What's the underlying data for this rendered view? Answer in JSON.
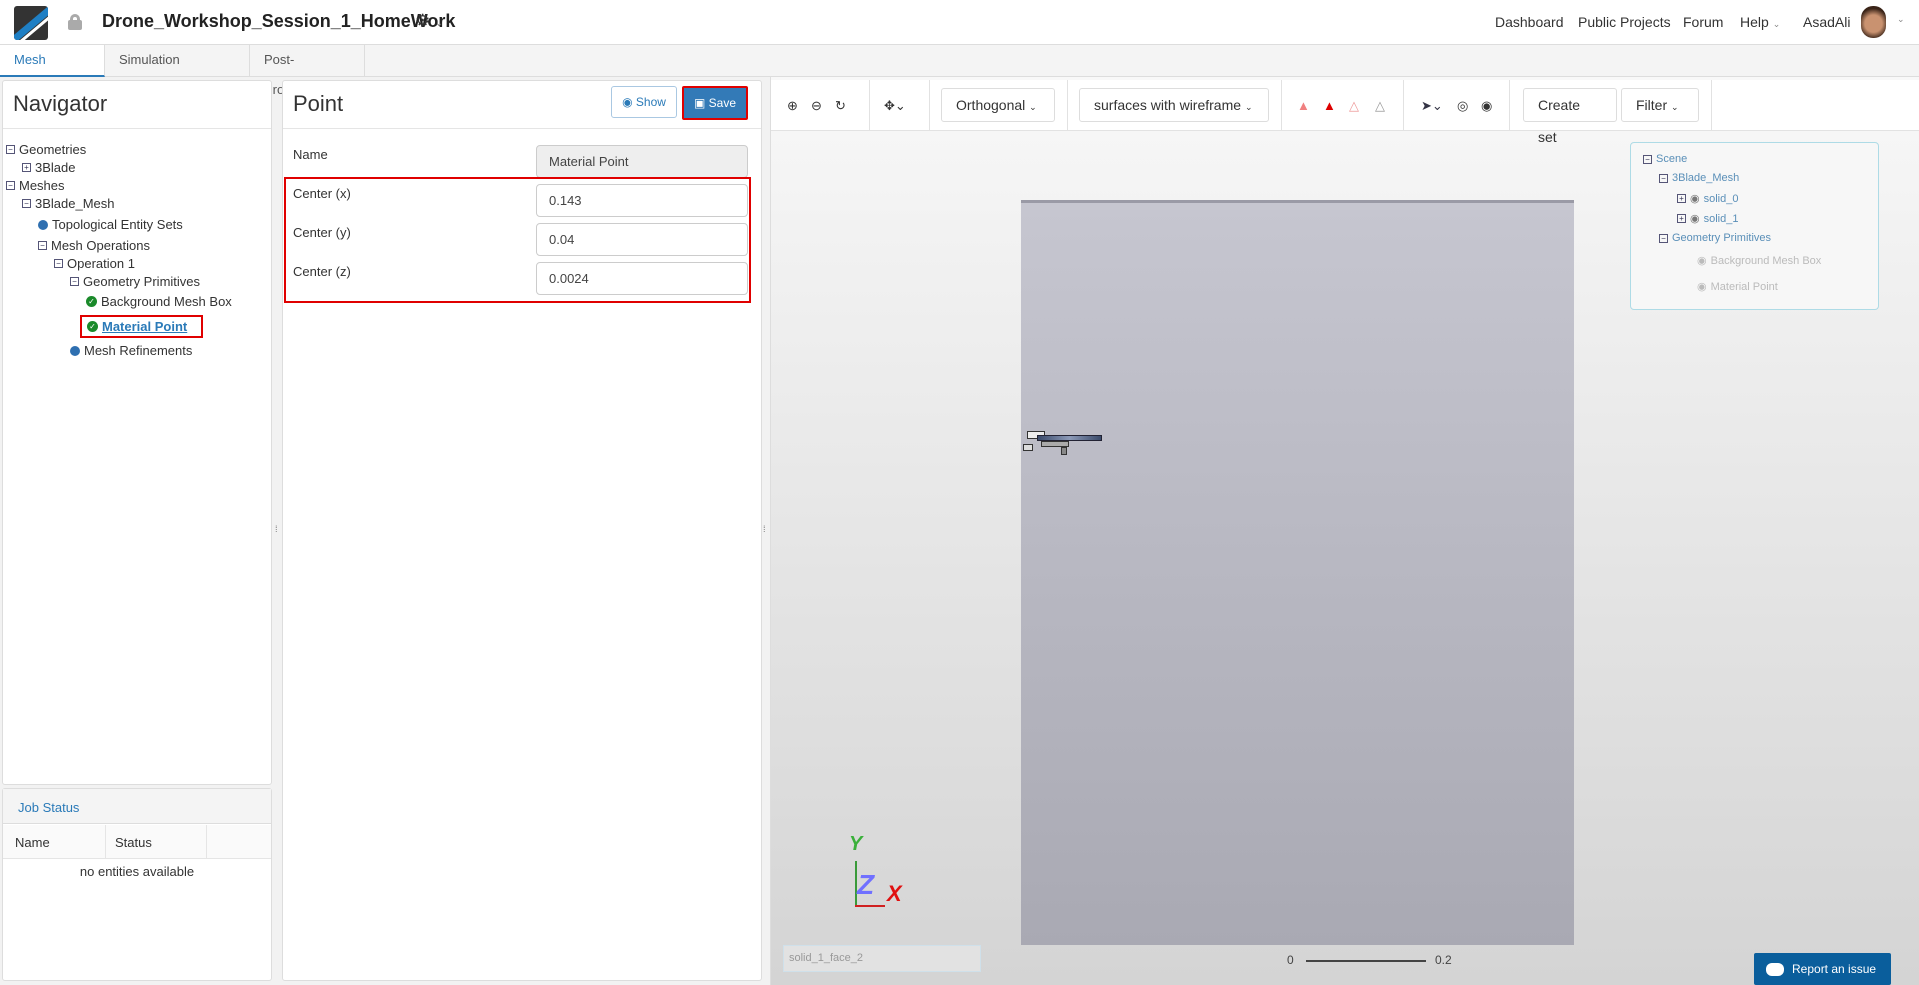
{
  "header": {
    "project_title": "Drone_Workshop_Session_1_HomeWork",
    "nav": [
      "Dashboard",
      "Public Projects",
      "Forum",
      "Help"
    ],
    "user": "AsadAli"
  },
  "tabs": [
    "Mesh Creator",
    "Simulation Designer",
    "Post-Processor"
  ],
  "navigator": {
    "title": "Navigator",
    "tree": [
      "Geometries",
      "3Blade",
      "Meshes",
      "3Blade_Mesh",
      "Topological Entity Sets",
      "Mesh Operations",
      "Operation 1",
      "Geometry Primitives",
      "Background Mesh Box",
      "Material Point",
      "Mesh Refinements"
    ]
  },
  "job_status": {
    "title": "Job Status",
    "columns": [
      "Name",
      "Status"
    ],
    "empty": "no entities available"
  },
  "point_panel": {
    "title": "Point",
    "show_label": "Show",
    "save_label": "Save",
    "fields": [
      {
        "label": "Name",
        "value": "Material Point"
      },
      {
        "label": "Center (x)",
        "value": "0.143"
      },
      {
        "label": "Center (y)",
        "value": "0.04"
      },
      {
        "label": "Center (z)",
        "value": "0.0024"
      }
    ]
  },
  "toolbar": {
    "projection": "Orthogonal",
    "render_mode": "surfaces with wireframe",
    "create_set": "Create set",
    "filter": "Filter"
  },
  "scene_tree": [
    "Scene",
    "3Blade_Mesh",
    "solid_0",
    "solid_1",
    "Geometry Primitives",
    "Background Mesh Box",
    "Material Point"
  ],
  "viewer": {
    "selection_text": "solid_1_face_2",
    "scale_min": "0",
    "scale_max": "0.2",
    "axis_x": "X",
    "axis_y": "Y",
    "axis_z": "Z",
    "report_label": "Report an issue"
  },
  "colors": {
    "accent": "#2a7ab8",
    "save": "#337ab7",
    "highlight": "#e00000",
    "report": "#0a5e9c"
  }
}
